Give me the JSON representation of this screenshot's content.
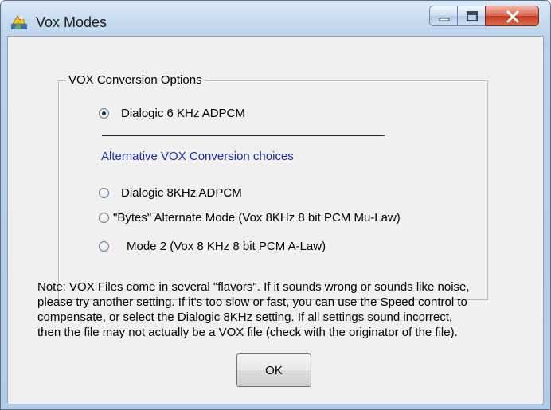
{
  "window": {
    "title": "Vox Modes"
  },
  "controls": {
    "minimize": "minimize",
    "maximize": "maximize",
    "close": "close"
  },
  "group": {
    "legend": "VOX Conversion Options",
    "primary_option": {
      "label": "Dialogic 6 KHz ADPCM",
      "selected": true
    },
    "alternatives_heading": "Alternative VOX Conversion choices",
    "alternatives": [
      {
        "label": "Dialogic  8KHz ADPCM",
        "selected": false
      },
      {
        "label": "\"Bytes\" Alternate Mode (Vox 8KHz 8 bit PCM Mu-Law)",
        "selected": false
      },
      {
        "label": "Mode 2 (Vox 8 KHz 8 bit PCM A-Law)",
        "selected": false
      }
    ]
  },
  "note": {
    "lines": [
      "Note: VOX Files come in several \"flavors\". If it sounds wrong or sounds like noise,",
      "please try another setting. If it's too slow or fast, you can use the Speed control to",
      "compensate, or select the Dialogic 8KHz setting. If all settings sound incorrect,",
      "then the file may not actually be a VOX file (check with the originator of the file)."
    ]
  },
  "buttons": {
    "ok_label": "OK"
  },
  "colors": {
    "alt_heading": "#1b2fa8",
    "close_button": "#c43a22"
  }
}
